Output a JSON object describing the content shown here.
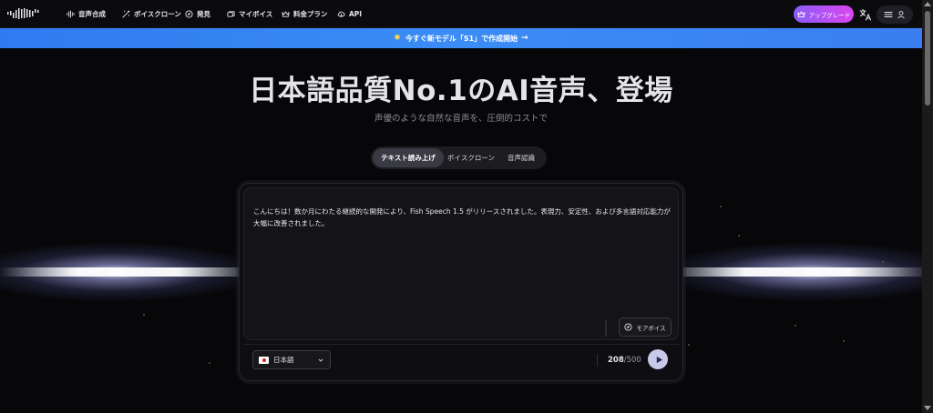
{
  "nav": {
    "items": [
      {
        "label": "音声合成",
        "icon": "waveform-icon"
      },
      {
        "label": "ボイスクローン",
        "icon": "magic-wand-icon"
      },
      {
        "label": "発見",
        "icon": "compass-icon"
      },
      {
        "label": "マイボイス",
        "icon": "layers-icon"
      },
      {
        "label": "料金プラン",
        "icon": "crown-icon"
      },
      {
        "label": "API",
        "icon": "cloud-icon"
      }
    ],
    "upgrade_label": "アップグレード"
  },
  "banner": {
    "text": "今すぐ新モデル「S1」で作成開始",
    "arrow": "→"
  },
  "hero": {
    "title": "日本語品質No.1のAI音声、登場",
    "subtitle": "声優のような自然な音声を、圧倒的コストで"
  },
  "tabs": [
    {
      "label": "テキスト読み上げ",
      "active": true
    },
    {
      "label": "ボイスクローン",
      "active": false
    },
    {
      "label": "音声認識",
      "active": false
    }
  ],
  "editor": {
    "text_line1": "こんにちは！数か月にわたる継続的な開発により、Fish Speech 1.5 がリリースされました。表現力、安定性、および多言語対応能力が",
    "text_line2": "大幅に改善されました。",
    "more_voices_label": "モアボイス",
    "language": "日本語",
    "char_count": "208",
    "char_max": "/500"
  },
  "colors": {
    "accent_banner": "#3b8cf5",
    "upgrade_gradient_start": "#8b5cf6",
    "upgrade_gradient_end": "#d946ef",
    "play_button": "#c9c9ec"
  }
}
